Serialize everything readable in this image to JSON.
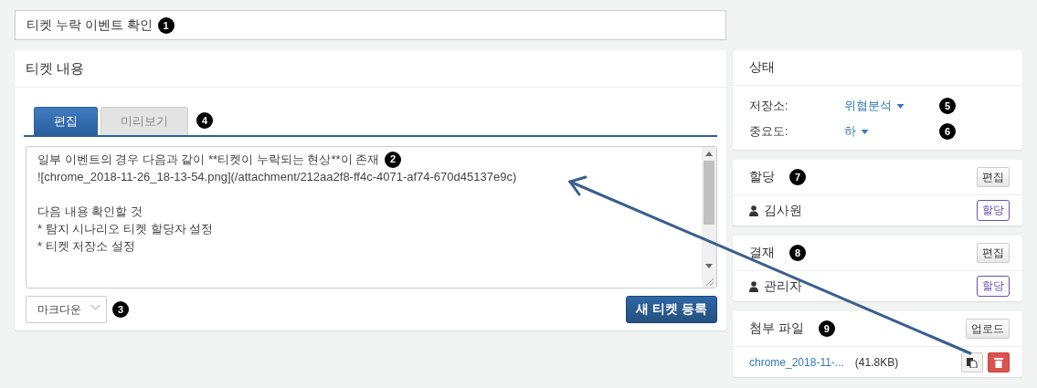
{
  "title_field": {
    "value": "티켓 누락 이벤트 확인",
    "marker": "1"
  },
  "content_panel": {
    "title": "티켓 내용",
    "tabs": [
      {
        "label": "편집",
        "selected": true
      },
      {
        "label": "미리보기",
        "selected": false
      }
    ],
    "tabs_marker": "4",
    "editor": {
      "marker": "2",
      "paragraphs": [
        [
          "일부 이벤트의 경우 다음과 같이 **티켓이 누락되는 현상**이 존재",
          "![chrome_2018-11-26_18-13-54.png](/attachment/212aa2f8-ff4c-4071-af74-670d45137e9c)"
        ],
        [
          "다음 내용 확인할 것",
          "* 탐지 시나리오 티켓 할당자 설정",
          "* 티켓 저장소 설정"
        ]
      ]
    },
    "format_select": {
      "value": "마크다운",
      "marker": "3"
    },
    "submit_button": "새 티켓 등록"
  },
  "status_panel": {
    "title": "상태",
    "fields": [
      {
        "label": "저장소:",
        "value": "위협분석",
        "marker": "5"
      },
      {
        "label": "중요도:",
        "value": "하",
        "marker": "6"
      }
    ]
  },
  "people_panels": [
    {
      "title": "할당",
      "marker": "7",
      "edit_button": "편집",
      "person": "김사원",
      "assign_button": "할당"
    },
    {
      "title": "결재",
      "marker": "8",
      "edit_button": "편집",
      "person": "관리자",
      "assign_button": "할당"
    }
  ],
  "attachments": {
    "title": "첨부 파일",
    "marker": "9",
    "upload_button": "업로드",
    "files": [
      {
        "name": "chrome_2018-11-...",
        "size": "(41.8KB)"
      }
    ]
  }
}
